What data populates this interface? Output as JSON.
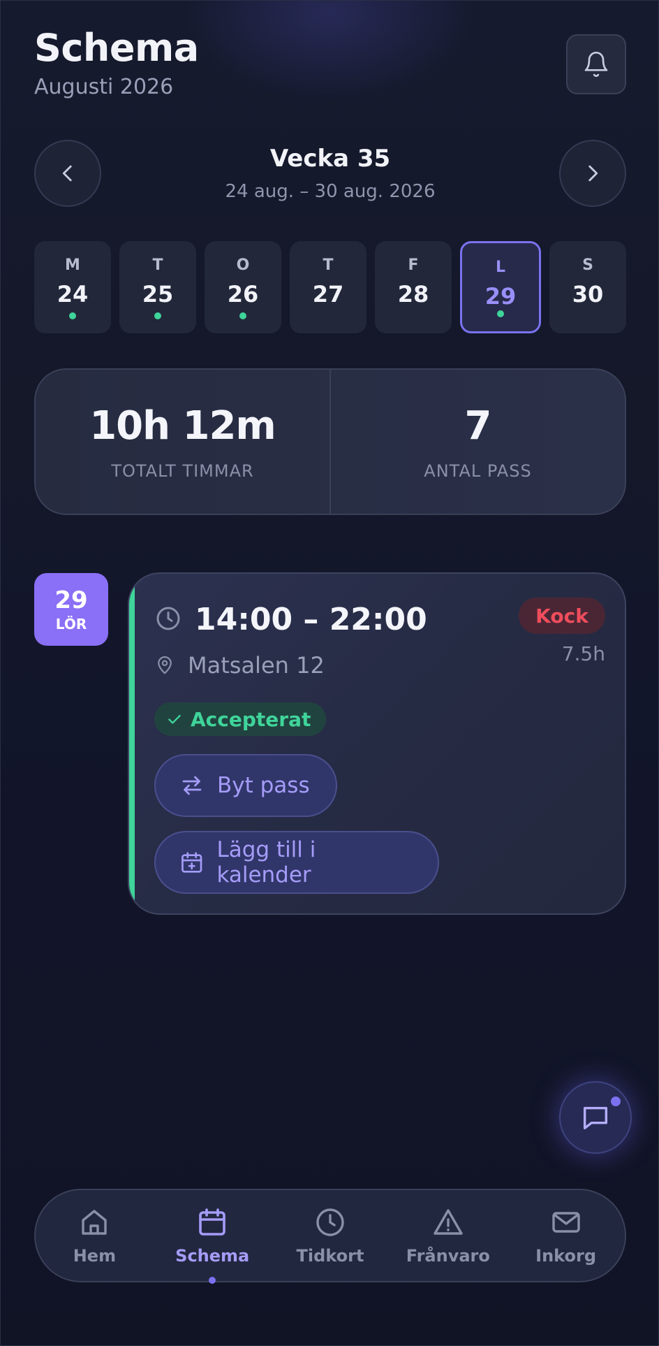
{
  "header": {
    "title": "Schema",
    "subtitle": "Augusti 2026",
    "bell_icon": "bell-icon"
  },
  "week": {
    "title": "Vecka 35",
    "range": "24 aug. – 30 aug. 2026",
    "prev_icon": "chevron-left-icon",
    "next_icon": "chevron-right-icon"
  },
  "days": [
    {
      "letter": "M",
      "num": "24",
      "has_shift": true,
      "selected": false
    },
    {
      "letter": "T",
      "num": "25",
      "has_shift": true,
      "selected": false
    },
    {
      "letter": "O",
      "num": "26",
      "has_shift": true,
      "selected": false
    },
    {
      "letter": "T",
      "num": "27",
      "has_shift": false,
      "selected": false
    },
    {
      "letter": "F",
      "num": "28",
      "has_shift": false,
      "selected": false
    },
    {
      "letter": "L",
      "num": "29",
      "has_shift": true,
      "selected": true
    },
    {
      "letter": "S",
      "num": "30",
      "has_shift": false,
      "selected": false
    }
  ],
  "stats": {
    "hours_value": "10h 12m",
    "hours_label": "TOTALT TIMMAR",
    "shifts_value": "7",
    "shifts_label": "ANTAL PASS"
  },
  "date_badge": {
    "num": "29",
    "dow": "LÖR"
  },
  "shift": {
    "time": "14:00 – 22:00",
    "role": "Kock",
    "duration": "7.5h",
    "location": "Matsalen 12",
    "status": "Accepterat",
    "swap_label": "Byt pass",
    "calendar_label": "Lägg till i kalender",
    "accent_color": "#3fd49a",
    "role_color": "#ef4d5c"
  },
  "bottom_nav": {
    "items": [
      {
        "label": "Hem",
        "icon": "home-icon",
        "active": false
      },
      {
        "label": "Schema",
        "icon": "calendar-icon",
        "active": true
      },
      {
        "label": "Tidkort",
        "icon": "clock-icon",
        "active": false
      },
      {
        "label": "Frånvaro",
        "icon": "warning-icon",
        "active": false
      },
      {
        "label": "Inkorg",
        "icon": "mail-icon",
        "active": false
      }
    ]
  },
  "colors": {
    "accent": "#7a72f0",
    "success": "#3fd49a",
    "danger": "#ef4d5c",
    "background": "#141829"
  }
}
